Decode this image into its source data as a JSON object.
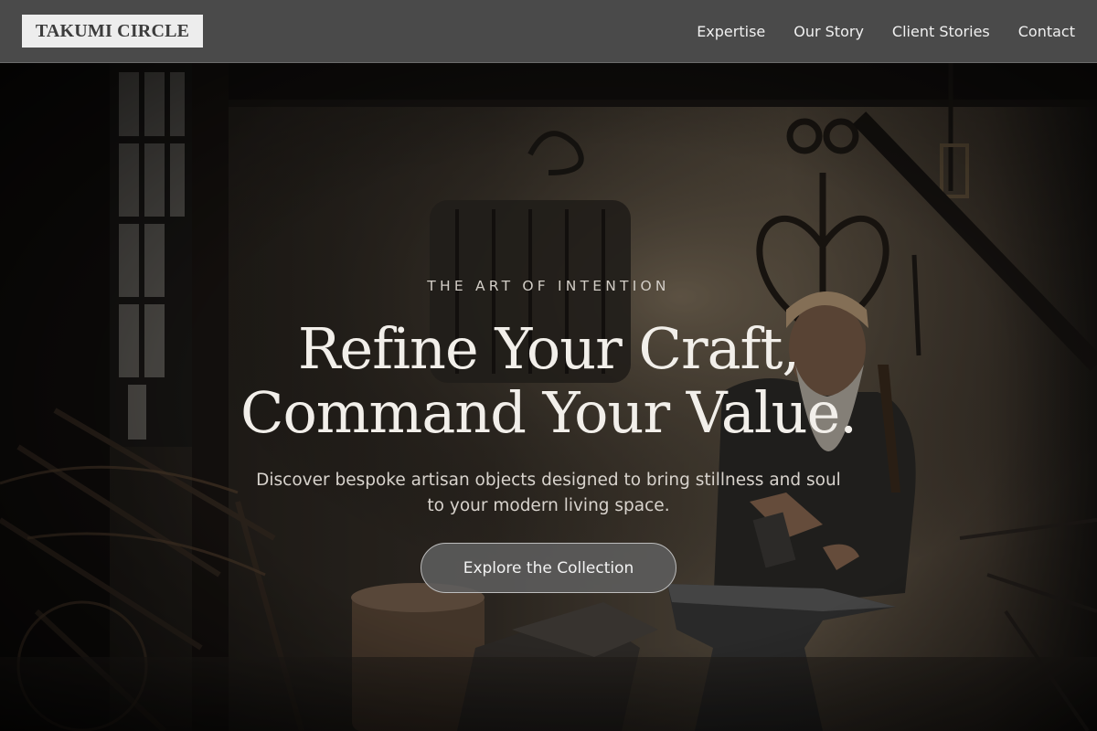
{
  "header": {
    "logo_text": "TAKUMI CIRCLE",
    "nav": [
      {
        "label": "Expertise"
      },
      {
        "label": "Our Story"
      },
      {
        "label": "Client Stories"
      },
      {
        "label": "Contact"
      }
    ]
  },
  "hero": {
    "eyebrow": "THE ART OF INTENTION",
    "headline_line1": "Refine Your Craft,",
    "headline_line2": "Command Your Value.",
    "subtext": "Discover bespoke artisan objects designed to bring stillness and soul to your modern living space.",
    "cta_label": "Explore the Collection",
    "background_description": "photo-blacksmith-workshop"
  },
  "colors": {
    "header_bg": "#4a4a4a",
    "logo_bg": "#ededed",
    "headline": "#f2efea",
    "cta_bg": "#5f5f5f"
  }
}
